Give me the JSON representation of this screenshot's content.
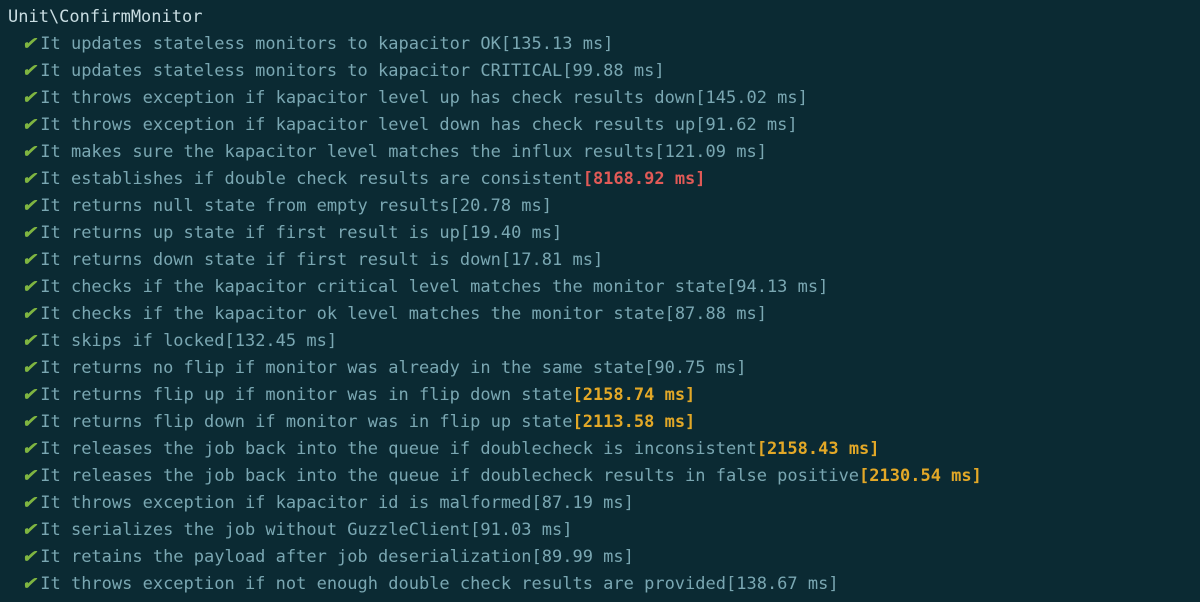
{
  "suite_header": "Unit\\ConfirmMonitor",
  "check_glyph": "✔",
  "tests": [
    {
      "desc": "It updates stateless monitors to kapacitor OK",
      "time": "[135.13 ms]",
      "level": "normal"
    },
    {
      "desc": "It updates stateless monitors to kapacitor CRITICAL",
      "time": "[99.88 ms]",
      "level": "normal"
    },
    {
      "desc": "It throws exception if kapacitor level up has check results down",
      "time": "[145.02 ms]",
      "level": "normal"
    },
    {
      "desc": "It throws exception if kapacitor level down has check results up",
      "time": "[91.62 ms]",
      "level": "normal"
    },
    {
      "desc": "It makes sure the kapacitor level matches the influx results",
      "time": "[121.09 ms]",
      "level": "normal"
    },
    {
      "desc": "It establishes if double check results are consistent",
      "time": "[8168.92 ms]",
      "level": "slow"
    },
    {
      "desc": "It returns null state from empty results",
      "time": "[20.78 ms]",
      "level": "normal"
    },
    {
      "desc": "It returns up state if first result is up",
      "time": "[19.40 ms]",
      "level": "normal"
    },
    {
      "desc": "It returns down state if first result is down",
      "time": "[17.81 ms]",
      "level": "normal"
    },
    {
      "desc": "It checks if the kapacitor critical level matches the monitor state",
      "time": "[94.13 ms]",
      "level": "normal"
    },
    {
      "desc": "It checks if the kapacitor ok level matches the monitor state",
      "time": "[87.88 ms]",
      "level": "normal"
    },
    {
      "desc": "It skips if locked",
      "time": "[132.45 ms]",
      "level": "normal"
    },
    {
      "desc": "It returns no flip if monitor was already in the same state",
      "time": "[90.75 ms]",
      "level": "normal"
    },
    {
      "desc": "It returns flip up if monitor was in flip down state",
      "time": "[2158.74 ms]",
      "level": "warn"
    },
    {
      "desc": "It returns flip down if monitor was in flip up state",
      "time": "[2113.58 ms]",
      "level": "warn"
    },
    {
      "desc": "It releases the job back into the queue if doublecheck is inconsistent",
      "time": "[2158.43 ms]",
      "level": "warn"
    },
    {
      "desc": "It releases the job back into the queue if doublecheck results in false positive",
      "time": "[2130.54 ms]",
      "level": "warn"
    },
    {
      "desc": "It throws exception if kapacitor id is malformed",
      "time": "[87.19 ms]",
      "level": "normal"
    },
    {
      "desc": "It serializes the job without GuzzleClient",
      "time": "[91.03 ms]",
      "level": "normal"
    },
    {
      "desc": "It retains the payload after job deserialization",
      "time": "[89.99 ms]",
      "level": "normal"
    },
    {
      "desc": "It throws exception if not enough double check results are provided",
      "time": "[138.67 ms]",
      "level": "normal"
    }
  ]
}
